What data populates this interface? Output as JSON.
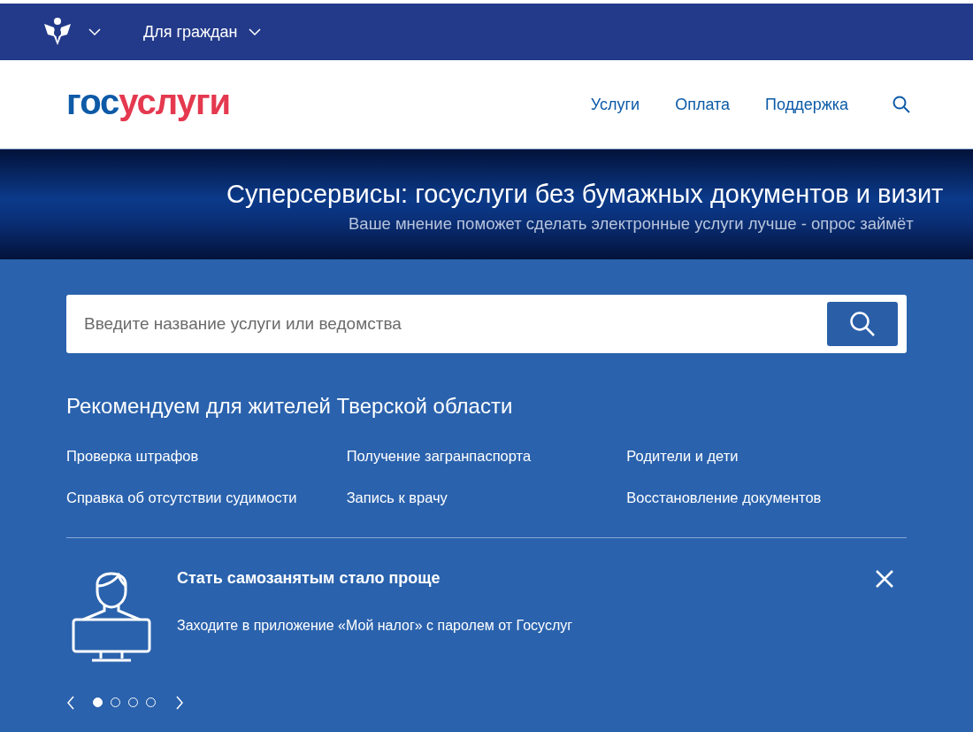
{
  "top_bar": {
    "section": "Для граждан"
  },
  "header": {
    "logo": [
      {
        "text": "гос",
        "color": "#0d5aa7"
      },
      {
        "text": "услуги",
        "color": "#e4394f"
      }
    ],
    "nav": [
      "Услуги",
      "Оплата",
      "Поддержка"
    ]
  },
  "banner": {
    "title": "Суперсервисы: госуслуги без бумажных документов и визит",
    "subtitle": "Ваше мнение поможет сделать электронные услуги лучше - опрос займёт"
  },
  "search": {
    "placeholder": "Введите название услуги или ведомства"
  },
  "recommended": {
    "title": "Рекомендуем для жителей Тверской области",
    "links": [
      "Проверка штрафов",
      "Получение загранпаспорта",
      "Родители и дети",
      "Справка об отсутствии судимости",
      "Запись к врачу",
      "Восстановление документов"
    ]
  },
  "promo": {
    "title": "Стать самозанятым стало проще",
    "text": "Заходите в приложение «Мой налог» с паролем от Госуслуг",
    "dots": [
      {
        "selected": true
      },
      {
        "selected": false
      },
      {
        "selected": false
      },
      {
        "selected": false
      }
    ]
  }
}
